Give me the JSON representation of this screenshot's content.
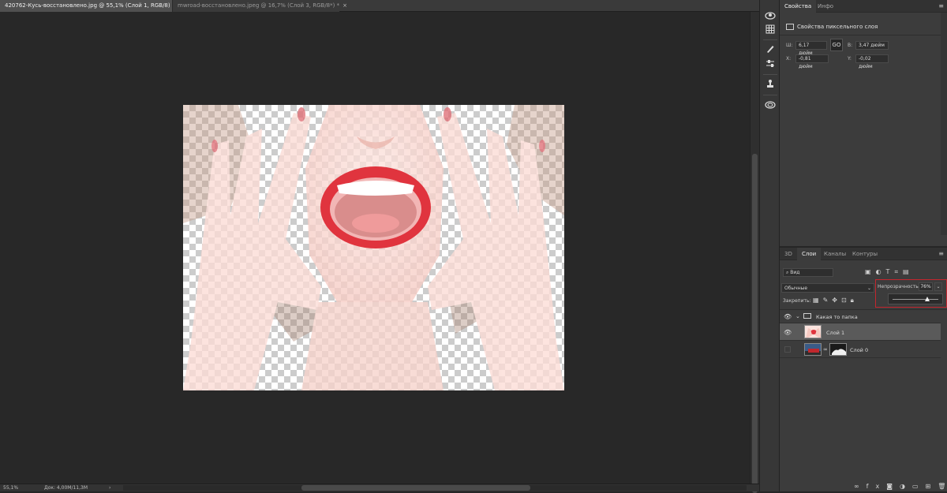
{
  "tabs": [
    {
      "title": "420762-Кусь-восстановлено.jpg @ 55,1% (Слой 1, RGB/8) *",
      "close": "×"
    },
    {
      "title": "mwroad-восстановлено.jpeg @ 16,7% (Слой 3, RGB/8*) *",
      "close": "×"
    }
  ],
  "status": {
    "zoom": "55,1%",
    "doc": "Док: 4,00M/11,3M",
    "arrow": "›"
  },
  "properties_panel": {
    "tabs": [
      "Свойства",
      "Инфо"
    ],
    "header": "Свойства пиксельного слоя",
    "w_label": "Ш:",
    "w_value": "6,17 дюйм",
    "link_symbol": "GO",
    "h_label": "В:",
    "h_value": "3,47 дюйм",
    "x_label": "X:",
    "x_value": "-0,81 дюйм",
    "y_label": "Y:",
    "y_value": "-0,02 дюйм"
  },
  "layers_panel": {
    "tabs": [
      "3D",
      "Слои",
      "Каналы",
      "Контуры"
    ],
    "filter_kind": "⌕ Вид",
    "blend_mode": "Обычные",
    "opacity_label": "Непрозрачность:",
    "opacity_value": "76%",
    "opacity_level": 0.76,
    "lock_label": "Закрепить:",
    "layers": [
      {
        "name": "Какая то папка",
        "type": "group",
        "visible": true
      },
      {
        "name": "Слой 1",
        "type": "pixel",
        "visible": true,
        "selected": true
      },
      {
        "name": "Слой 0",
        "type": "pixel-with-mask",
        "visible": false
      }
    ]
  },
  "icons": {
    "toolstrip": [
      "3d-icon",
      "grid-icon",
      "brush-icon",
      "adjust-sliders-icon",
      "clone-stamp-icon",
      "layers-3d-icon"
    ],
    "bottom": [
      "link-icon",
      "fx-icon",
      "mask-icon",
      "adjustment-icon",
      "folder-icon",
      "new-layer-icon",
      "trash-icon"
    ]
  },
  "colors": {
    "selection_highlight": "#c4262e",
    "selected_layer": "#5a5a5a"
  }
}
